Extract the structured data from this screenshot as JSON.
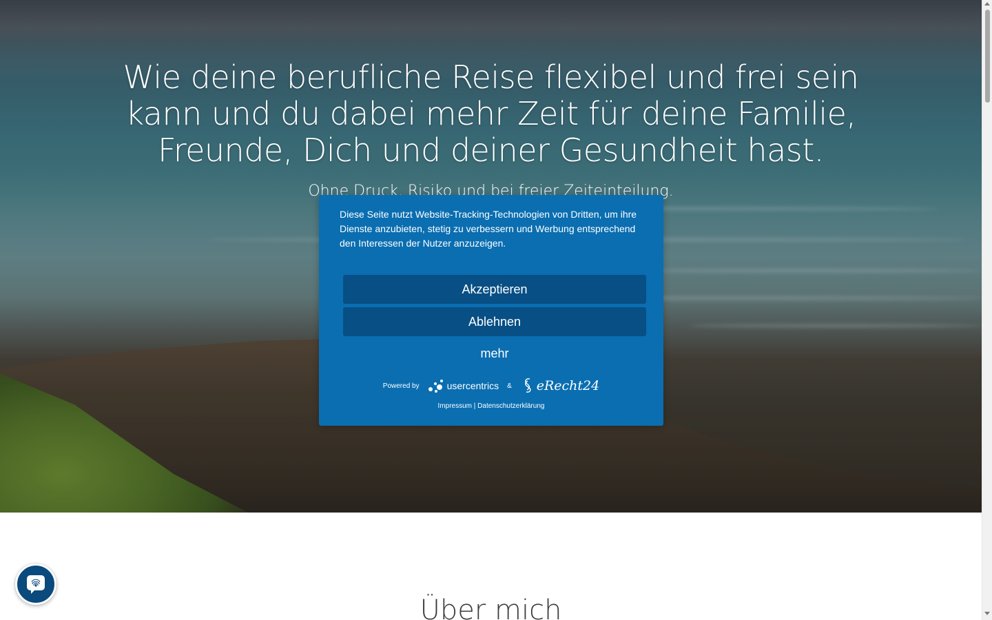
{
  "hero": {
    "title": "Wie deine berufliche Reise flexibel und frei sein kann und du dabei mehr Zeit für deine Familie, Freunde, Dich und deiner Gesundheit hast.",
    "subtitle": "Ohne Druck, Risiko und bei freier Zeiteinteilung."
  },
  "consent": {
    "text": "Diese Seite nutzt Website-Tracking-Technologien von Dritten, um ihre Dienste anzubieten, stetig zu verbessern und Werbung entsprechend den Interessen der Nutzer anzuzeigen.",
    "accept_label": "Akzeptieren",
    "decline_label": "Ablehnen",
    "more_label": "mehr",
    "powered_by": "Powered by",
    "usercentrics_logo_text": "usercentrics",
    "ampersand": "&",
    "erecht_logo_text": "eRecht24",
    "impressum_label": "Impressum",
    "link_separator": "|",
    "privacy_label": "Datenschutzerklärung",
    "background_color": "#0a6eb1",
    "button_color": "#074f84"
  },
  "section": {
    "title": "Über mich"
  },
  "fab": {
    "icon": "fingerprint-icon"
  }
}
